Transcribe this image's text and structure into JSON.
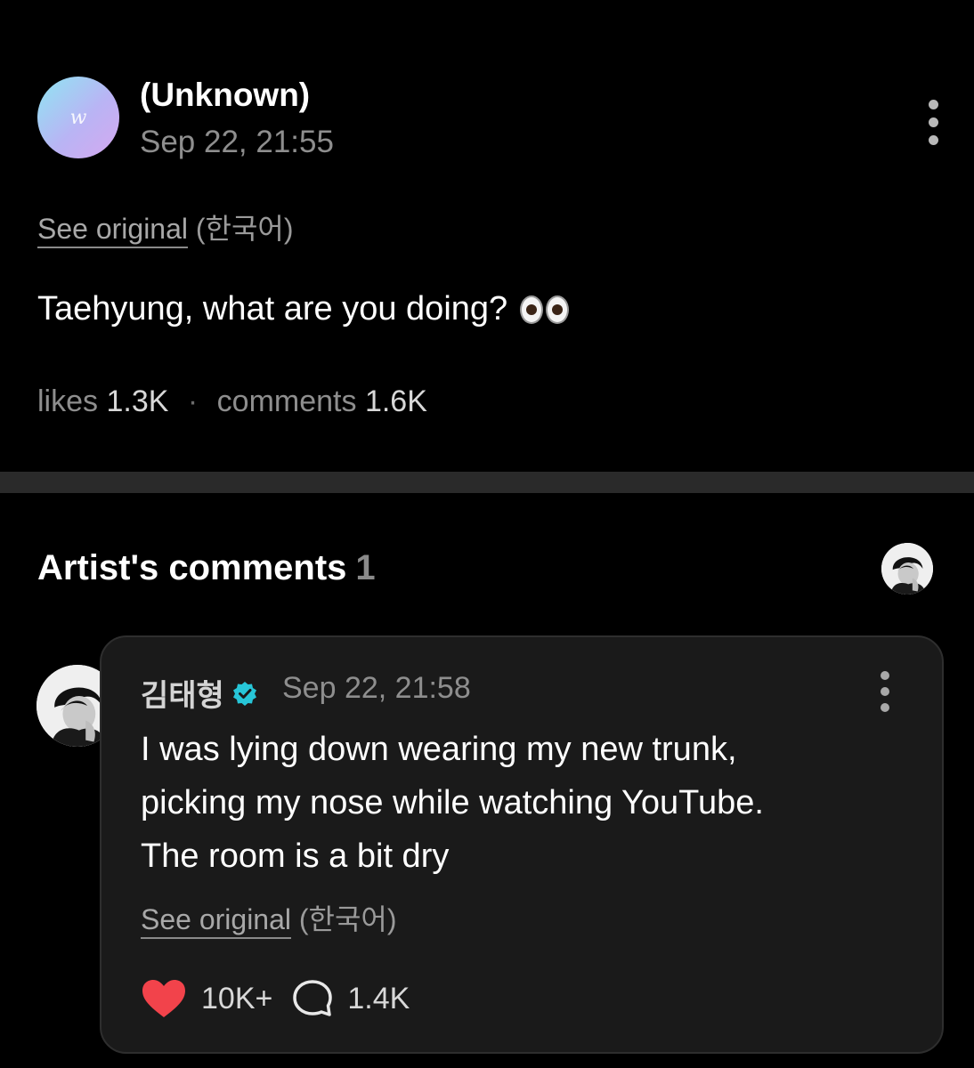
{
  "post": {
    "author": "(Unknown)",
    "time": "Sep 22, 21:55",
    "avatar_logo": "w",
    "see_original": {
      "link": "See original",
      "lang": "(한국어)"
    },
    "text": "Taehyung, what are you doing?",
    "emoji_icon": "eyes-emoji",
    "stats": {
      "likes_label": "likes",
      "likes": "1.3K",
      "separator": "·",
      "comments_label": "comments",
      "comments": "1.6K"
    }
  },
  "artist_comments": {
    "title": "Artist's comments",
    "count": "1"
  },
  "comment": {
    "author": "김태형",
    "time": "Sep 22, 21:58",
    "lines": [
      "I was lying down wearing my new trunk,",
      "picking my nose while watching YouTube.",
      "The room is a bit dry"
    ],
    "see_original": {
      "link": "See original",
      "lang": "(한국어)"
    },
    "likes": "10K+",
    "replies": "1.4K"
  },
  "colors": {
    "background": "#000000",
    "divider": "#2a2a2a",
    "card": "#1a1a1a",
    "muted_text": "#8e8e8e",
    "heart": "#f2434b",
    "verified": "#27c6d8"
  }
}
